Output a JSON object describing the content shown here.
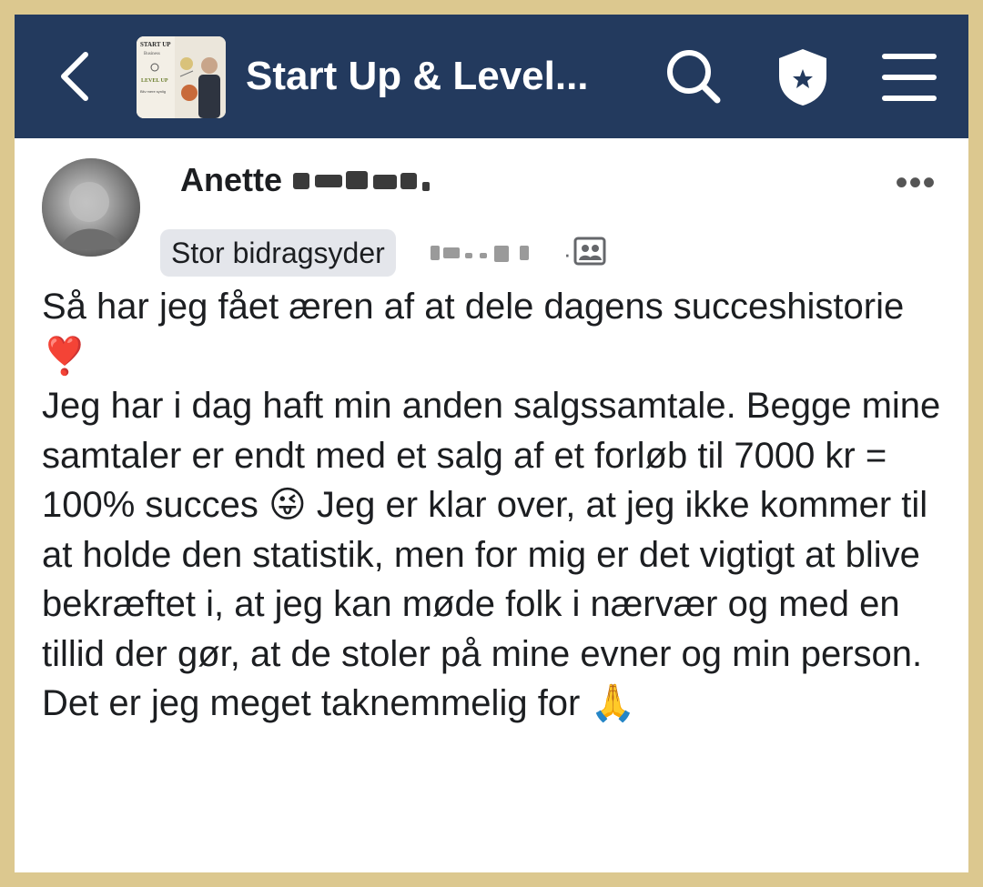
{
  "header": {
    "back_icon": "chevron-left-icon",
    "group_thumb_text": {
      "line1": "START UP",
      "line2": "Business",
      "line3": "LEVEL UP",
      "line4": "Bliv mere synlig"
    },
    "title": "Start Up & Level...",
    "search_icon": "search-icon",
    "shield_icon": "shield-star-icon",
    "menu_icon": "hamburger-menu-icon"
  },
  "post": {
    "author_first_name": "Anette",
    "badge": "Stor bidragsyder",
    "audience_icon": "members-icon",
    "more_icon": "more-horizontal-icon",
    "paragraphs": [
      "Så har jeg fået æren af at dele dagens succeshistorie ❣️",
      "Jeg har i dag haft min anden salgssamtale. Begge mine samtaler er endt med et salg af et forløb til 7000 kr = 100% succes 😜 Jeg er klar over, at jeg ikke kommer til at holde den statistik, men for mig er det vigtigt at blive bekræftet i, at jeg kan møde folk i nærvær og med en tillid der gør, at de stoler på mine evner og min person. Det er jeg meget taknemmelig for 🙏"
    ]
  },
  "colors": {
    "border": "#dcc88f",
    "header_bg": "#233a5e",
    "badge_bg": "#e4e6eb",
    "text": "#1c1e21"
  }
}
